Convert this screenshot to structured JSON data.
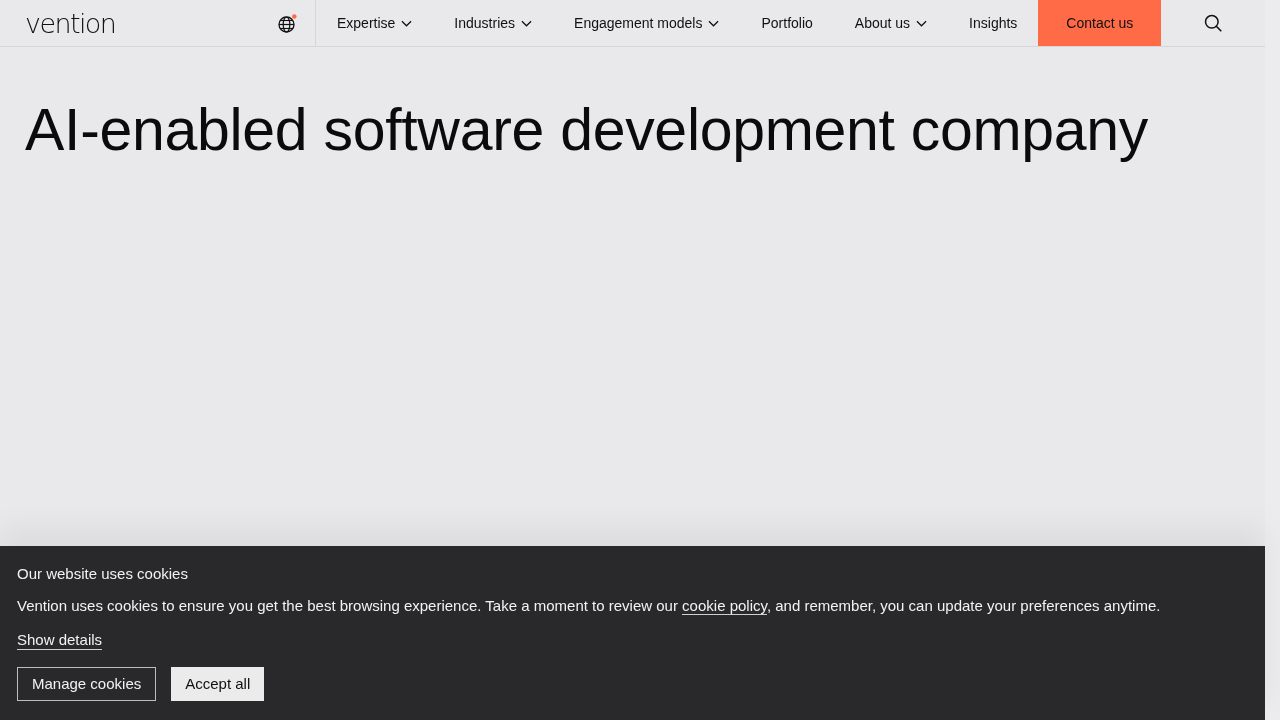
{
  "header": {
    "logo": "vention",
    "nav": [
      {
        "label": "Expertise",
        "dropdown": true
      },
      {
        "label": "Industries",
        "dropdown": true
      },
      {
        "label": "Engagement models",
        "dropdown": true
      },
      {
        "label": "Portfolio",
        "dropdown": false
      },
      {
        "label": "About us",
        "dropdown": true
      },
      {
        "label": "Insights",
        "dropdown": false
      }
    ],
    "cta": "Contact us"
  },
  "hero": {
    "title": "AI-enabled software development company"
  },
  "cookie_banner": {
    "title": "Our website uses cookies",
    "message": {
      "before": "Vention uses cookies to ensure you get the best browsing experience. Take a moment to review our ",
      "link": "cookie policy",
      "after": ", and remember, you can update your preferences anytime."
    },
    "details_link": "Show details",
    "buttons": [
      {
        "label": "Manage cookies",
        "kind": "outline"
      },
      {
        "label": "Accept all",
        "kind": "filled"
      }
    ]
  }
}
